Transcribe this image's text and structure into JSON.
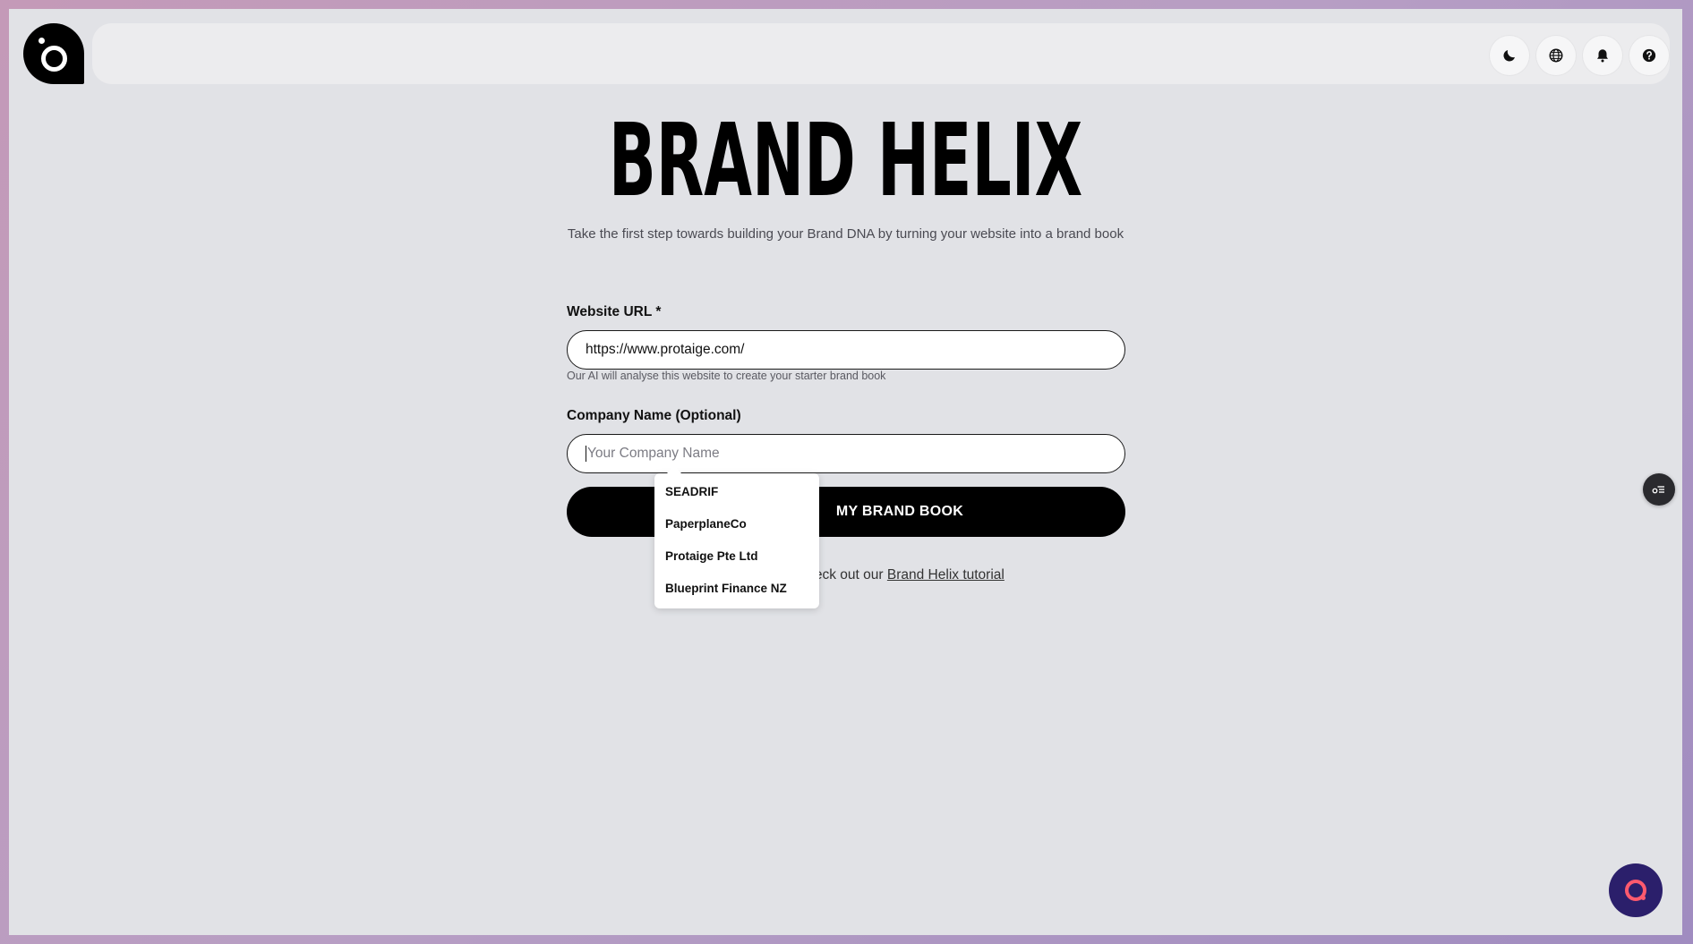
{
  "header": {
    "icons": [
      "moon-icon",
      "globe-icon",
      "bell-icon",
      "help-icon"
    ]
  },
  "main": {
    "title": "BRAND HELIX",
    "subtitle": "Take the first step towards building your Brand DNA by turning your website into a brand book",
    "website_label": "Website URL *",
    "website_value": "https://www.protaige.com/",
    "website_hint": "Our AI will analyse this website to create your starter brand book",
    "company_label": "Company Name (Optional)",
    "company_placeholder": "Your Company Name",
    "submit_label": "MY BRAND BOOK",
    "help_prefix": "? Check out our",
    "help_link": "Brand Helix tutorial"
  },
  "autocomplete": {
    "options": [
      "SEADRIF",
      "PaperplaneCo",
      "Protaige Pte Ltd",
      "Blueprint Finance NZ"
    ]
  },
  "colors": {
    "background": "#e1e2e6",
    "accent": "#000000",
    "chat_bubble": "#2b1f6b",
    "chat_logo": "#ff5a6e"
  }
}
